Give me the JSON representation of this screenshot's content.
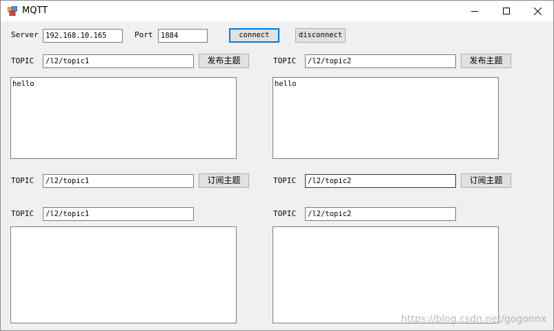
{
  "window": {
    "title": "MQTT"
  },
  "connection": {
    "server_label": "Server",
    "server_value": "192.168.10.165",
    "port_label": "Port",
    "port_value": "1884",
    "connect_label": "connect",
    "disconnect_label": "disconnect"
  },
  "publish": [
    {
      "topic_label": "TOPIC",
      "topic_value": "/l2/topic1",
      "button_label": "发布主题",
      "message": "hello"
    },
    {
      "topic_label": "TOPIC",
      "topic_value": "/l2/topic2",
      "button_label": "发布主题",
      "message": "hello"
    }
  ],
  "subscribe": [
    {
      "topic_label": "TOPIC",
      "topic_value": "/l2/topic1",
      "button_label": "订阅主题"
    },
    {
      "topic_label": "TOPIC",
      "topic_value": "/l2/topic2",
      "button_label": "订阅主题"
    }
  ],
  "received": [
    {
      "topic_label": "TOPIC",
      "topic_value": "/l2/topic1",
      "message": ""
    },
    {
      "topic_label": "TOPIC",
      "topic_value": "/l2/topic2",
      "message": ""
    }
  ],
  "watermark": "https://blog.csdn.net/gogonnx"
}
